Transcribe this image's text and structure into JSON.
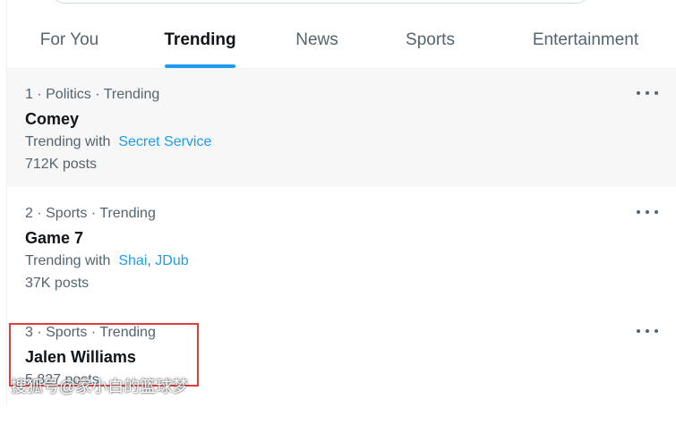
{
  "tabs": [
    {
      "label": "For You",
      "active": false
    },
    {
      "label": "Trending",
      "active": true
    },
    {
      "label": "News",
      "active": false
    },
    {
      "label": "Sports",
      "active": false
    },
    {
      "label": "Entertainment",
      "active": false
    }
  ],
  "colors": {
    "accent": "#1d9bf0",
    "secondary_text": "#536471",
    "primary_text": "#0f1419",
    "highlight_box": "#e23b3b"
  },
  "trends": [
    {
      "meta": "1 · Politics · Trending",
      "title": "Comey",
      "with_prefix": "Trending with",
      "with_links": [
        "Secret Service"
      ],
      "posts": "712K posts"
    },
    {
      "meta": "2 · Sports · Trending",
      "title": "Game 7",
      "with_prefix": "Trending with",
      "with_links": [
        "Shai",
        "JDub"
      ],
      "posts": "37K posts"
    },
    {
      "meta": "3 · Sports · Trending",
      "title": "Jalen Williams",
      "posts": "5,827 posts"
    }
  ],
  "overlay": {
    "watermark_text": "搜狐号@家小白的篮球梦"
  },
  "icons": {
    "more": "more-horizontal-icon"
  }
}
